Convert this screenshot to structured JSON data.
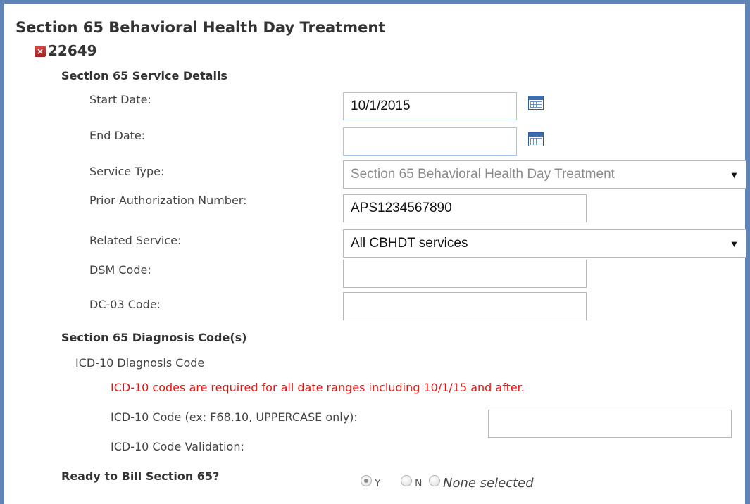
{
  "section": {
    "title": "Section 65 Behavioral Health Day Treatment",
    "record_id": "22649"
  },
  "service_details": {
    "heading": "Section 65 Service Details",
    "start_date": {
      "label": "Start Date:",
      "value": "10/1/2015"
    },
    "end_date": {
      "label": "End Date:",
      "value": ""
    },
    "service_type": {
      "label": "Service Type:",
      "value": "Section 65 Behavioral Health Day Treatment"
    },
    "prior_auth": {
      "label": "Prior Authorization Number:",
      "value": "APS1234567890"
    },
    "related_service": {
      "label": "Related Service:",
      "value": "All CBHDT services"
    },
    "dsm_code": {
      "label": "DSM Code:",
      "value": ""
    },
    "dc03_code": {
      "label": "DC-03 Code:",
      "value": ""
    }
  },
  "diagnosis": {
    "heading": "Section 65 Diagnosis Code(s)",
    "icd_heading": "ICD-10 Diagnosis Code",
    "warning": "ICD-10 codes are required for all date ranges including 10/1/15 and after.",
    "icd_code_label": "ICD-10 Code (ex: F68.10, UPPERCASE only):",
    "icd_code_value": "",
    "validation_label": "ICD-10 Code Validation:"
  },
  "ready_to_bill": {
    "label": "Ready to Bill Section 65?",
    "options": [
      "Y",
      "N",
      "None selected"
    ],
    "selected": "Y"
  },
  "icons": {
    "remove": "remove-x-icon",
    "calendar": "calendar-icon",
    "dropdown": "chevron-down-icon"
  },
  "colors": {
    "frame": "#5f84b5",
    "warning": "#ee1111",
    "remove": "#b52828",
    "focused_border": "#a8c6ea"
  }
}
